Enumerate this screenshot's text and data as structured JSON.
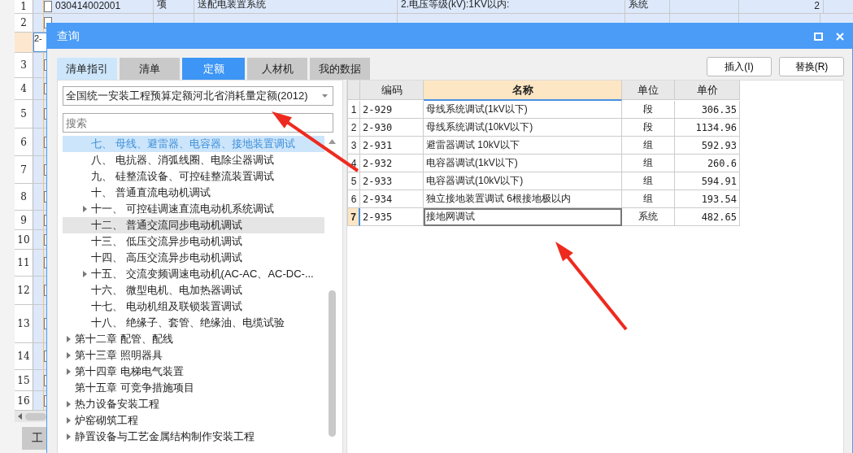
{
  "sheet": {
    "rows": [
      {
        "number": "1",
        "code": "030414002001",
        "type": "项",
        "name": "送配电装置系统",
        "description": "2.电压等级(kV):1KV以内:",
        "unit": "系统",
        "quantity": "2"
      },
      {
        "number": "2"
      }
    ],
    "current_row_code": "2-",
    "row_numbers": [
      "3",
      "4",
      "5",
      "6",
      "7",
      "8",
      "9",
      "10",
      "11",
      "12",
      "13",
      "14",
      "15",
      "16"
    ],
    "bottom_tab": "工"
  },
  "dialog": {
    "title": "查询",
    "tabs": [
      {
        "label": "清单指引",
        "selected": false,
        "kind": "light"
      },
      {
        "label": "清单",
        "selected": false,
        "kind": "grey"
      },
      {
        "label": "定额",
        "selected": true,
        "kind": "grey"
      },
      {
        "label": "人材机",
        "selected": false,
        "kind": "grey"
      },
      {
        "label": "我的数据",
        "selected": false,
        "kind": "grey"
      }
    ],
    "buttons": [
      "插入(I)",
      "替换(R)"
    ],
    "library": {
      "value": "全国统一安装工程预算定额河北省消耗量定额(2012)"
    },
    "search": {
      "placeholder": "搜索"
    },
    "tree": [
      {
        "children": [
          {
            "children": [
              {
                "label": "七、 母线、避雷器、电容器、接地装置调试",
                "kind": "leaf",
                "selected": true,
                "hovered": false
              },
              {
                "label": "八、 电抗器、消弧线圈、电除尘器调试",
                "kind": "leaf",
                "selected": false,
                "hovered": false
              },
              {
                "label": "九、 硅整流设备、可控硅整流装置调试",
                "kind": "leaf",
                "selected": false,
                "hovered": false
              },
              {
                "label": "十、 普通直流电动机调试",
                "kind": "leaf",
                "selected": false,
                "hovered": false
              },
              {
                "label": "十一、 可控硅调速直流电动机系统调试",
                "kind": "folder",
                "selected": false,
                "hovered": false
              },
              {
                "label": "十二、 普通交流同步电动机调试",
                "kind": "leaf",
                "selected": false,
                "hovered": true
              },
              {
                "label": "十三、 低压交流异步电动机调试",
                "kind": "leaf",
                "selected": false,
                "hovered": false
              },
              {
                "label": "十四、 高压交流异步电动机调试",
                "kind": "leaf",
                "selected": false,
                "hovered": false
              },
              {
                "label": "十五、 交流变频调速电动机(AC-AC、AC-DC-...",
                "kind": "folder",
                "selected": false,
                "hovered": false
              },
              {
                "label": "十六、 微型电机、电加热器调试",
                "kind": "leaf",
                "selected": false,
                "hovered": false
              },
              {
                "label": "十七、 电动机组及联锁装置调试",
                "kind": "leaf",
                "selected": false,
                "hovered": false
              },
              {
                "label": "十八、 绝缘子、套管、绝缘油、电缆试验",
                "kind": "leaf",
                "selected": false,
                "hovered": false
              }
            ]
          },
          {
            "label": "第十二章 配管、配线",
            "kind": "folder",
            "selected": false,
            "hovered": false
          },
          {
            "label": "第十三章 照明器具",
            "kind": "folder",
            "selected": false,
            "hovered": false
          },
          {
            "label": "第十四章 电梯电气装置",
            "kind": "folder",
            "selected": false,
            "hovered": false
          },
          {
            "label": "第十五章 可竞争措施项目",
            "kind": "leaf",
            "selected": false,
            "hovered": false
          }
        ]
      },
      {
        "label": "热力设备安装工程",
        "kind": "folder",
        "selected": false,
        "hovered": false
      },
      {
        "label": "炉窑砌筑工程",
        "kind": "folder",
        "selected": false,
        "hovered": false
      },
      {
        "label": "静置设备与工艺金属结构制作安装工程",
        "kind": "folder",
        "selected": false,
        "hovered": false
      }
    ],
    "table": {
      "columns": [
        {
          "label": "编码",
          "selected": false
        },
        {
          "label": "名称",
          "selected": true
        },
        {
          "label": "单位",
          "selected": false
        },
        {
          "label": "单价",
          "selected": false
        }
      ],
      "rows": [
        {
          "number": "1",
          "code": "2-929",
          "name": "母线系统调试(1kV以下)",
          "unit": "段",
          "price": "306.35",
          "selected": false
        },
        {
          "number": "2",
          "code": "2-930",
          "name": "母线系统调试(10kV以下)",
          "unit": "段",
          "price": "1134.96",
          "selected": false
        },
        {
          "number": "3",
          "code": "2-931",
          "name": "避雷器调试 10kV以下",
          "unit": "组",
          "price": "592.93",
          "selected": false
        },
        {
          "number": "4",
          "code": "2-932",
          "name": "电容器调试(1kV以下)",
          "unit": "组",
          "price": "260.6",
          "selected": false
        },
        {
          "number": "5",
          "code": "2-933",
          "name": "电容器调试(10kV以下)",
          "unit": "组",
          "price": "594.91",
          "selected": false
        },
        {
          "number": "6",
          "code": "2-934",
          "name": "独立接地装置调试 6根接地极以内",
          "unit": "组",
          "price": "193.54",
          "selected": false
        },
        {
          "number": "7",
          "code": "2-935",
          "name": "接地网调试",
          "unit": "系统",
          "price": "482.65",
          "selected": true
        }
      ]
    }
  }
}
